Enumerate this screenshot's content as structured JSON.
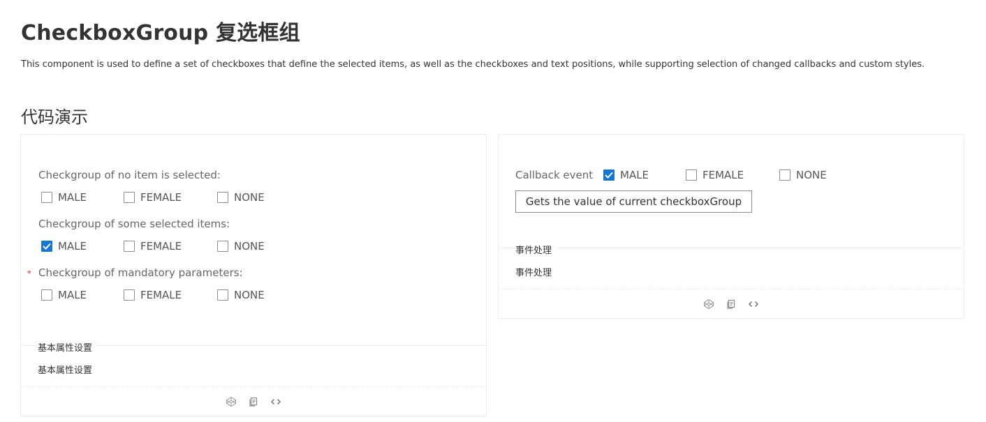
{
  "page": {
    "title": "CheckboxGroup 复选框组",
    "description": "This component is used to define a set of checkboxes that define the selected items, as well as the checkboxes and text positions, while supporting selection of changed callbacks and custom styles.",
    "section_title": "代码演示"
  },
  "left_demo": {
    "groups": [
      {
        "label": "Checkgroup of no item is selected:",
        "required": false,
        "options": [
          {
            "label": "MALE",
            "checked": false
          },
          {
            "label": "FEMALE",
            "checked": false
          },
          {
            "label": "NONE",
            "checked": false
          }
        ]
      },
      {
        "label": "Checkgroup of some selected items:",
        "required": false,
        "options": [
          {
            "label": "MALE",
            "checked": true
          },
          {
            "label": "FEMALE",
            "checked": false
          },
          {
            "label": "NONE",
            "checked": false
          }
        ]
      },
      {
        "label": "Checkgroup of mandatory parameters:",
        "required": true,
        "required_mark": "*",
        "options": [
          {
            "label": "MALE",
            "checked": false
          },
          {
            "label": "FEMALE",
            "checked": false
          },
          {
            "label": "NONE",
            "checked": false
          }
        ]
      }
    ],
    "meta_title": "基本属性设置",
    "meta_description": "基本属性设置",
    "actions": [
      "codepen-icon",
      "copy-icon",
      "code-icon"
    ]
  },
  "right_demo": {
    "label": "Callback event",
    "options": [
      {
        "label": "MALE",
        "checked": true
      },
      {
        "label": "FEMALE",
        "checked": false
      },
      {
        "label": "NONE",
        "checked": false
      }
    ],
    "button_label": "Gets the value of current checkboxGroup",
    "meta_title": "事件处理",
    "meta_description": "事件处理",
    "actions": [
      "codepen-icon",
      "copy-icon",
      "code-icon"
    ]
  },
  "colors": {
    "checked": "#1677d2",
    "required": "#e5403c",
    "border": "#ebedf0"
  }
}
